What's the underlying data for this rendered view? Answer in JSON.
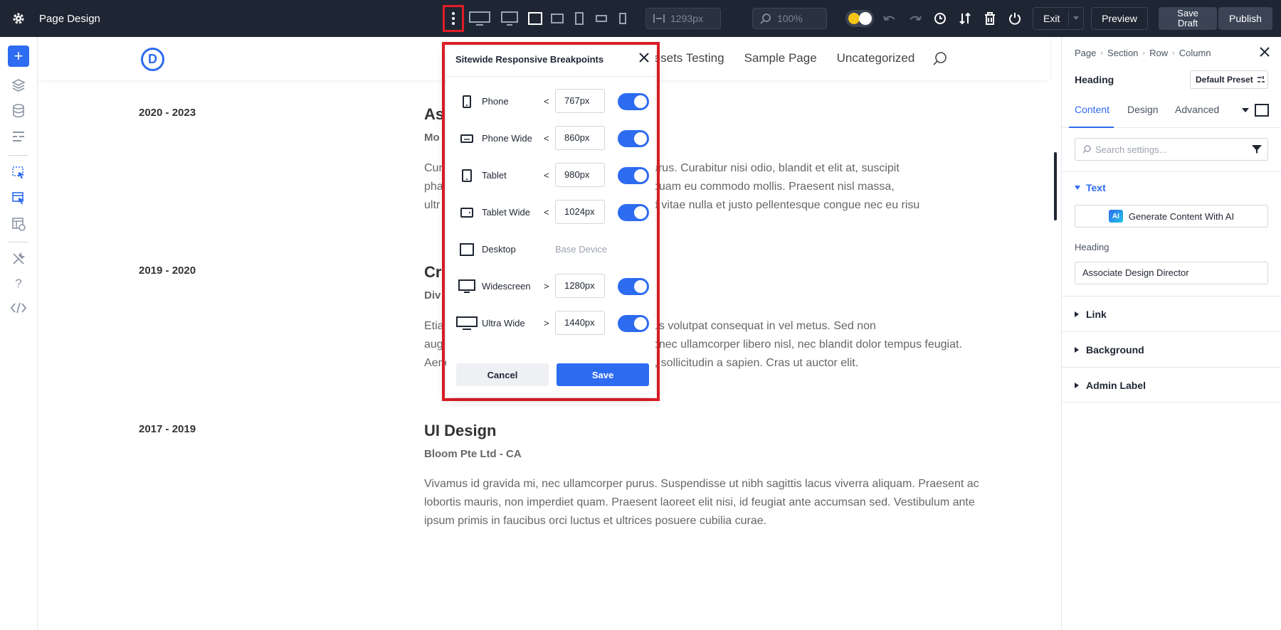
{
  "topbar": {
    "title": "Page Design",
    "width_value": "1293px",
    "zoom_value": "100%",
    "exit_label": "Exit",
    "preview_label": "Preview",
    "save_draft_label": "Save Draft",
    "publish_label": "Publish"
  },
  "site": {
    "nav": [
      "resets Testing",
      "Sample Page",
      "Uncategorized"
    ]
  },
  "entries": [
    {
      "date": "2020 - 2023",
      "title": "As",
      "sub": "Mo",
      "body": "Cur                                                              r purus. Curabitur nisi odio, blandit et elit at, suscipit pha                                                       lacinia quam eu commodo mollis. Praesent nisl massa, ultr                                                          ci. Sed vitae nulla et justo pellentesque congue nec eu risu"
    },
    {
      "date": "2019 - 2020",
      "title": "Cr",
      "sub": "Div",
      "body": "Etia                                                       on metus volutpat consequat in vel metus. Sed non aug                                                         lus. Donec ullamcorper libero nisl, nec blandit dolor tempus feugiat. Aenean neque felis, fringilla nec placerat eget, sollicitudin a sapien. Cras ut auctor elit."
    },
    {
      "date": "2017 - 2019",
      "title": "UI Design",
      "sub": "Bloom Pte Ltd - CA",
      "body": "Vivamus id gravida mi, nec ullamcorper purus. Suspendisse ut nibh sagittis lacus viverra aliquam. Praesent ac lobortis mauris, non imperdiet quam. Praesent laoreet elit nisi, id feugiat ante accumsan sed. Vestibulum ante ipsum primis in faucibus orci luctus et ultrices posuere cubilia curae."
    }
  ],
  "modal": {
    "title": "Sitewide Responsive Breakpoints",
    "breakpoints": [
      {
        "label": "Phone",
        "op": "<",
        "value": "767px",
        "enabled": true,
        "icon": "phone-icon"
      },
      {
        "label": "Phone Wide",
        "op": "<",
        "value": "860px",
        "enabled": true,
        "icon": "phone-wide-icon"
      },
      {
        "label": "Tablet",
        "op": "<",
        "value": "980px",
        "enabled": true,
        "icon": "tablet-icon"
      },
      {
        "label": "Tablet Wide",
        "op": "<",
        "value": "1024px",
        "enabled": true,
        "icon": "tablet-wide-icon"
      },
      {
        "label": "Desktop",
        "op": "",
        "value": "Base Device",
        "enabled": null,
        "icon": "desktop-icon"
      },
      {
        "label": "Widescreen",
        "op": ">",
        "value": "1280px",
        "enabled": true,
        "icon": "widescreen-icon"
      },
      {
        "label": "Ultra Wide",
        "op": ">",
        "value": "1440px",
        "enabled": true,
        "icon": "ultra-wide-icon"
      }
    ],
    "cancel_label": "Cancel",
    "save_label": "Save"
  },
  "rpanel": {
    "breadcrumb": [
      "Page",
      "Section",
      "Row",
      "Column"
    ],
    "element_label": "Heading",
    "preset_label": "Default Preset",
    "tabs": [
      "Content",
      "Design",
      "Advanced"
    ],
    "search_placeholder": "Search settings...",
    "text_group": "Text",
    "ai_button": "Generate Content With AI",
    "ai_badge": "AI",
    "heading_field_label": "Heading",
    "heading_field_value": "Associate Design Director",
    "groups": [
      "Link",
      "Background",
      "Admin Label"
    ]
  },
  "colors": {
    "accent": "#2d6bf0",
    "highlight": "#e11d27",
    "topbar": "#1f2633"
  }
}
